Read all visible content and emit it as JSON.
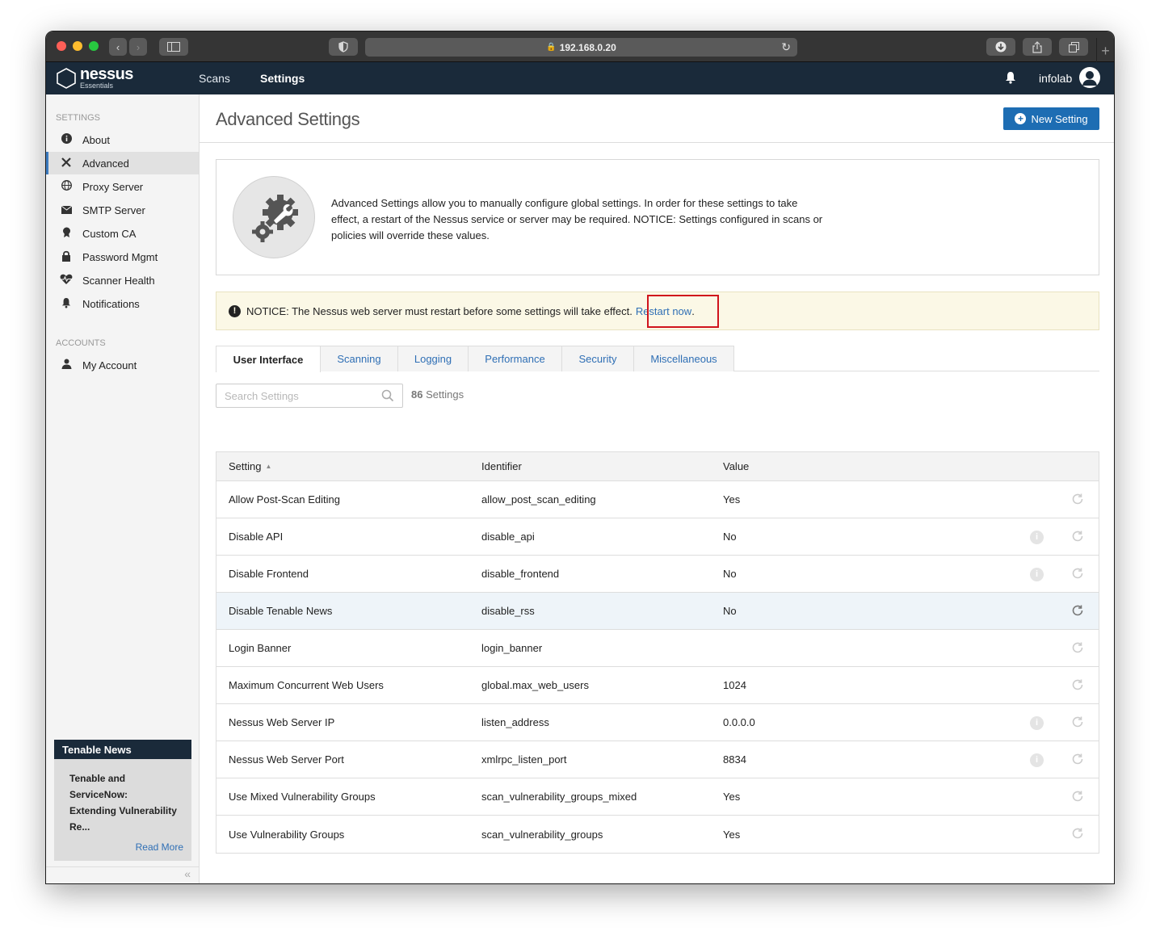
{
  "browser": {
    "url": "192.168.0.20"
  },
  "header": {
    "logo_name": "nessus",
    "logo_sub": "Essentials",
    "nav": {
      "scans": "Scans",
      "settings": "Settings"
    },
    "user": "infolab"
  },
  "sidebar": {
    "settings_heading": "SETTINGS",
    "settings_items": [
      {
        "label": "About",
        "icon": "info-circle-icon"
      },
      {
        "label": "Advanced",
        "icon": "tools-icon"
      },
      {
        "label": "Proxy Server",
        "icon": "globe-icon"
      },
      {
        "label": "SMTP Server",
        "icon": "envelope-icon"
      },
      {
        "label": "Custom CA",
        "icon": "certificate-icon"
      },
      {
        "label": "Password Mgmt",
        "icon": "lock-icon"
      },
      {
        "label": "Scanner Health",
        "icon": "heartbeat-icon"
      },
      {
        "label": "Notifications",
        "icon": "bell-icon"
      }
    ],
    "accounts_heading": "ACCOUNTS",
    "accounts_items": [
      {
        "label": "My Account",
        "icon": "user-icon"
      }
    ],
    "news": {
      "title": "Tenable News",
      "body": "Tenable and ServiceNow: Extending Vulnerability Re...",
      "read_more": "Read More"
    },
    "collapse_label": "«"
  },
  "main": {
    "title": "Advanced Settings",
    "new_button": "New Setting",
    "info_text": "Advanced Settings allow you to manually configure global settings. In order for these settings to take effect, a restart of the Nessus service or server may be required. NOTICE: Settings configured in scans or policies will override these values.",
    "notice_text": "NOTICE: The Nessus web server must restart before some settings will take effect.",
    "notice_link": "Restart now",
    "notice_period": ".",
    "tabs": [
      "User Interface",
      "Scanning",
      "Logging",
      "Performance",
      "Security",
      "Miscellaneous"
    ],
    "search_placeholder": "Search Settings",
    "count_number": "86",
    "count_label": "Settings",
    "columns": [
      "Setting",
      "Identifier",
      "Value"
    ],
    "rows": [
      {
        "setting": "Allow Post-Scan Editing",
        "identifier": "allow_post_scan_editing",
        "value": "Yes"
      },
      {
        "setting": "Disable API",
        "identifier": "disable_api",
        "value": "No"
      },
      {
        "setting": "Disable Frontend",
        "identifier": "disable_frontend",
        "value": "No"
      },
      {
        "setting": "Disable Tenable News",
        "identifier": "disable_rss",
        "value": "No"
      },
      {
        "setting": "Login Banner",
        "identifier": "login_banner",
        "value": ""
      },
      {
        "setting": "Maximum Concurrent Web Users",
        "identifier": "global.max_web_users",
        "value": "1024"
      },
      {
        "setting": "Nessus Web Server IP",
        "identifier": "listen_address",
        "value": "0.0.0.0"
      },
      {
        "setting": "Nessus Web Server Port",
        "identifier": "xmlrpc_listen_port",
        "value": "8834"
      },
      {
        "setting": "Use Mixed Vulnerability Groups",
        "identifier": "scan_vulnerability_groups_mixed",
        "value": "Yes"
      },
      {
        "setting": "Use Vulnerability Groups",
        "identifier": "scan_vulnerability_groups",
        "value": "Yes"
      }
    ]
  },
  "colors": {
    "header_bg": "#1a2a3a",
    "accent": "#1d6db3",
    "link": "#2f6fb5",
    "notice_bg": "#fbf8e6",
    "highlight_border": "#d0141c"
  }
}
